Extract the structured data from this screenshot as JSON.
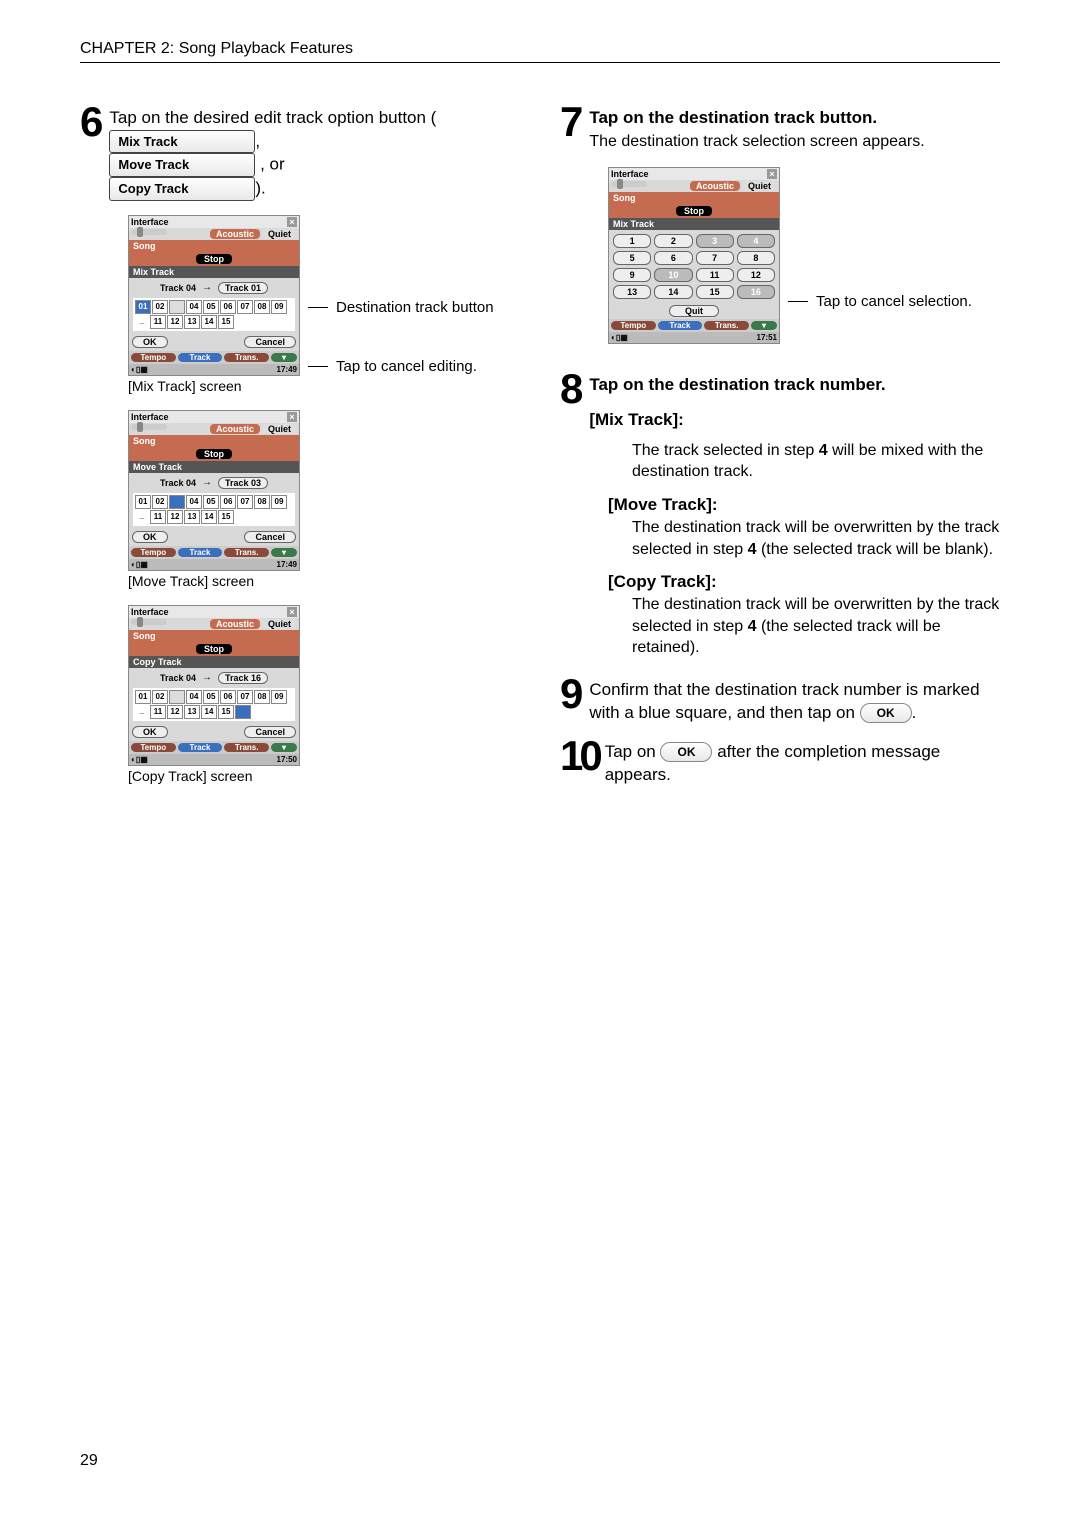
{
  "header": "CHAPTER 2: Song Playback Features",
  "page_number": "29",
  "steps": {
    "s6": {
      "num": "6",
      "text_a": "Tap on the desired edit track option button (",
      "btn_mix": "Mix Track",
      "sep1": ",",
      "btn_move": "Move Track",
      "sep2": ", or",
      "btn_copy": "Copy Track",
      "sep3": ")."
    },
    "s7": {
      "num": "7",
      "text": "Tap on the destination track button.",
      "sub": "The destination track selection screen appears."
    },
    "s8": {
      "num": "8",
      "text": "Tap on the destination track number.",
      "mix_h": "[Mix Track]:",
      "mix_p": "The track selected in step 4 will be mixed with the destination track.",
      "move_h": "[Move Track]:",
      "move_p": "The destination track will be overwritten by the track selected in step 4 (the selected track will be blank).",
      "copy_h": "[Copy Track]:",
      "copy_p": "The destination track will be overwritten by the track selected in step 4 (the selected track will be retained)."
    },
    "s9": {
      "num": "9",
      "text_a": "Confirm that the destination track number is marked with a blue square, and then tap on ",
      "ok": "OK",
      "text_b": "."
    },
    "s10": {
      "num": "10",
      "text_a": "Tap on ",
      "ok": "OK",
      "text_b": " after the completion message appears."
    }
  },
  "annotations": {
    "dest_btn": "Destination track button",
    "cancel_edit": "Tap to cancel editing.",
    "cancel_sel": "Tap to cancel selection."
  },
  "captions": {
    "mix": "[Mix Track] screen",
    "move": "[Move Track] screen",
    "copy": "[Copy Track] screen"
  },
  "mini_common": {
    "interface": "Interface",
    "acoustic": "Acoustic",
    "quiet": "Quiet",
    "song": "Song",
    "stop": "Stop",
    "track04": "Track 04",
    "ok": "OK",
    "cancel": "Cancel",
    "tempo": "Tempo",
    "track": "Track",
    "trans": "Trans.",
    "close": "×"
  },
  "mini_mix": {
    "section": "Mix Track",
    "dest": "Track 01",
    "nums1": [
      "01",
      "02",
      "",
      "04",
      "05",
      "06",
      "07",
      "08",
      "09",
      ""
    ],
    "nums2": [
      "11",
      "12",
      "13",
      "14",
      "15"
    ],
    "time": "17:49"
  },
  "mini_move": {
    "section": "Move Track",
    "dest": "Track 03",
    "nums1": [
      "01",
      "02",
      "",
      "04",
      "05",
      "06",
      "07",
      "08",
      "09",
      ""
    ],
    "nums2": [
      "11",
      "12",
      "13",
      "14",
      "15"
    ],
    "time": "17:49"
  },
  "mini_copy": {
    "section": "Copy Track",
    "dest": "Track 16",
    "nums1": [
      "01",
      "02",
      "",
      "04",
      "05",
      "06",
      "07",
      "08",
      "09",
      ""
    ],
    "nums2": [
      "11",
      "12",
      "13",
      "14",
      "15",
      ""
    ],
    "time": "17:50"
  },
  "mini_dest": {
    "section": "Mix Track",
    "grid": [
      "1",
      "2",
      "3",
      "4",
      "5",
      "6",
      "7",
      "8",
      "9",
      "10",
      "11",
      "12",
      "13",
      "14",
      "15",
      "16"
    ],
    "dims": [
      "3",
      "4",
      "10",
      "16"
    ],
    "quit": "Quit",
    "time": "17:51"
  }
}
